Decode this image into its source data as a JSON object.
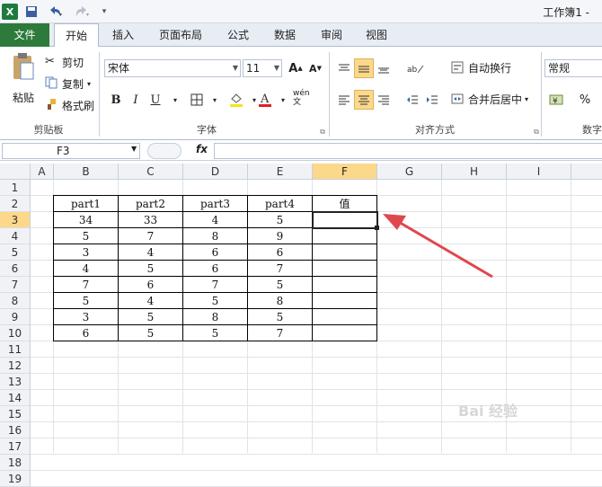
{
  "window": {
    "title": "工作簿1 - "
  },
  "tabs": [
    "文件",
    "开始",
    "插入",
    "页面布局",
    "公式",
    "数据",
    "审阅",
    "视图"
  ],
  "clipboard": {
    "paste": "粘贴",
    "cut": "剪切",
    "copy": "复制",
    "format_painter": "格式刷",
    "group": "剪贴板"
  },
  "font": {
    "name": "宋体",
    "size": "11",
    "group": "字体",
    "bold": "B",
    "italic": "I",
    "underline": "U",
    "grow": "A",
    "shrink": "A",
    "wen": "wén 文"
  },
  "alignment": {
    "wrap": "自动换行",
    "merge": "合并后居中",
    "group": "对齐方式"
  },
  "number": {
    "format": "常规",
    "percent": "%",
    "group": "数字"
  },
  "formula_bar": {
    "name_box": "F3",
    "fx": "fx",
    "formula": ""
  },
  "columns": [
    "A",
    "B",
    "C",
    "D",
    "E",
    "F",
    "G",
    "H",
    "I"
  ],
  "rows": [
    "1",
    "2",
    "3",
    "4",
    "5",
    "6",
    "7",
    "8",
    "9",
    "10",
    "11",
    "12",
    "13",
    "14",
    "15",
    "16",
    "17",
    "18",
    "19"
  ],
  "table": {
    "headers": [
      "part1",
      "part2",
      "part3",
      "part4",
      "值"
    ],
    "rows": [
      [
        "34",
        "33",
        "4",
        "5",
        ""
      ],
      [
        "5",
        "7",
        "8",
        "9",
        ""
      ],
      [
        "3",
        "4",
        "6",
        "6",
        ""
      ],
      [
        "4",
        "5",
        "6",
        "7",
        ""
      ],
      [
        "7",
        "6",
        "7",
        "5",
        ""
      ],
      [
        "5",
        "4",
        "5",
        "8",
        ""
      ],
      [
        "3",
        "5",
        "8",
        "5",
        ""
      ],
      [
        "6",
        "5",
        "5",
        "7",
        ""
      ]
    ]
  },
  "selected_cell": "F3",
  "colors": {
    "file_tab": "#2d7a3b",
    "selection_header": "#fcd88b",
    "arrow": "#e0474c"
  }
}
